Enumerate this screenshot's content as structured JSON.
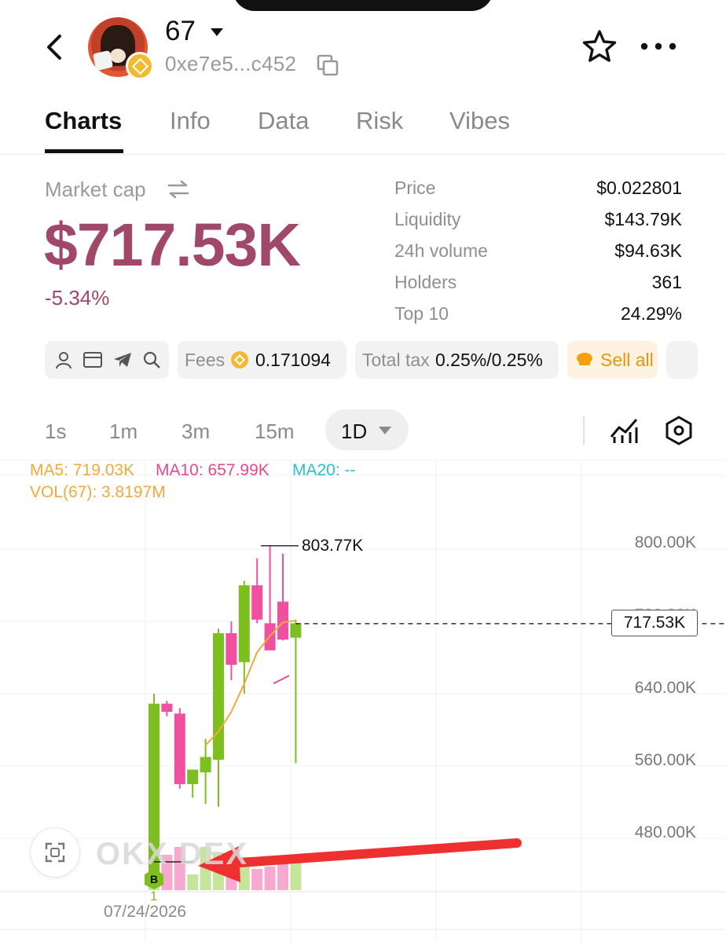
{
  "header": {
    "token_name": "67",
    "address": "0xe7e5...c452",
    "icons": [
      "back-arrow-icon",
      "chevron-down-icon",
      "copy-icon",
      "star-icon",
      "more-icon"
    ]
  },
  "tabs": [
    {
      "label": "Charts",
      "active": true
    },
    {
      "label": "Info",
      "active": false
    },
    {
      "label": "Data",
      "active": false
    },
    {
      "label": "Risk",
      "active": false
    },
    {
      "label": "Vibes",
      "active": false
    }
  ],
  "market": {
    "label": "Market cap",
    "value": "$717.53K",
    "change": "-5.34%",
    "stats": [
      {
        "label": "Price",
        "value": "$0.022801"
      },
      {
        "label": "Liquidity",
        "value": "$143.79K"
      },
      {
        "label": "24h volume",
        "value": "$94.63K"
      },
      {
        "label": "Holders",
        "value": "361"
      },
      {
        "label": "Top 10",
        "value": "24.29%"
      }
    ]
  },
  "chips": {
    "fees_label": "Fees",
    "fees_value": "0.171094",
    "tax_label": "Total tax",
    "tax_value": "0.25%/0.25%",
    "sell_all": "Sell all"
  },
  "intervals": {
    "items": [
      "1s",
      "1m",
      "3m",
      "15m"
    ],
    "active": "1D"
  },
  "chart": {
    "ma5_label": "MA5: 719.03K",
    "ma10_label": "MA10: 657.99K",
    "ma20_label": "MA20: --",
    "vol_label": "VOL(67): 3.8197M",
    "high_label": "803.77K",
    "current_price": "717.53K",
    "date_label": "07/24/2026",
    "buy_marker": "B",
    "buy_count": "1",
    "watermark": "OKX DEX",
    "colors": {
      "up": "#7cbf1e",
      "down": "#f050a0",
      "ma5": "#f2a93b",
      "ma10": "#e8488e",
      "ma20": "#2bbfd0",
      "arrow": "#ee3030"
    }
  },
  "chart_data": {
    "type": "candlestick",
    "y_ticks": [
      "800.00K",
      "720.00K",
      "640.00K",
      "560.00K",
      "480.00K"
    ],
    "ylim": [
      420,
      830
    ],
    "candles": [
      {
        "o": 440,
        "h": 640,
        "l": 440,
        "c": 629
      },
      {
        "o": 629,
        "h": 632,
        "l": 615,
        "c": 620
      },
      {
        "o": 618,
        "h": 624,
        "l": 535,
        "c": 540
      },
      {
        "o": 540,
        "h": 555,
        "l": 525,
        "c": 556
      },
      {
        "o": 553,
        "h": 590,
        "l": 518,
        "c": 570
      },
      {
        "o": 567,
        "h": 712,
        "l": 515,
        "c": 707
      },
      {
        "o": 707,
        "h": 720,
        "l": 655,
        "c": 672
      },
      {
        "o": 675,
        "h": 765,
        "l": 640,
        "c": 760
      },
      {
        "o": 760,
        "h": 790,
        "l": 718,
        "c": 722
      },
      {
        "o": 718,
        "h": 804,
        "l": 695,
        "c": 688
      },
      {
        "o": 742,
        "h": 795,
        "l": 699,
        "c": 700
      },
      {
        "o": 702,
        "h": 722,
        "l": 563,
        "c": 718
      }
    ],
    "ma5": [
      null,
      null,
      null,
      null,
      583,
      598,
      620,
      651,
      686,
      704,
      719,
      721
    ],
    "volume": [
      0.1,
      0.45,
      0.55,
      0.2,
      0.55,
      0.48,
      0.34,
      0.42,
      0.27,
      0.3,
      0.38,
      0.42
    ]
  }
}
